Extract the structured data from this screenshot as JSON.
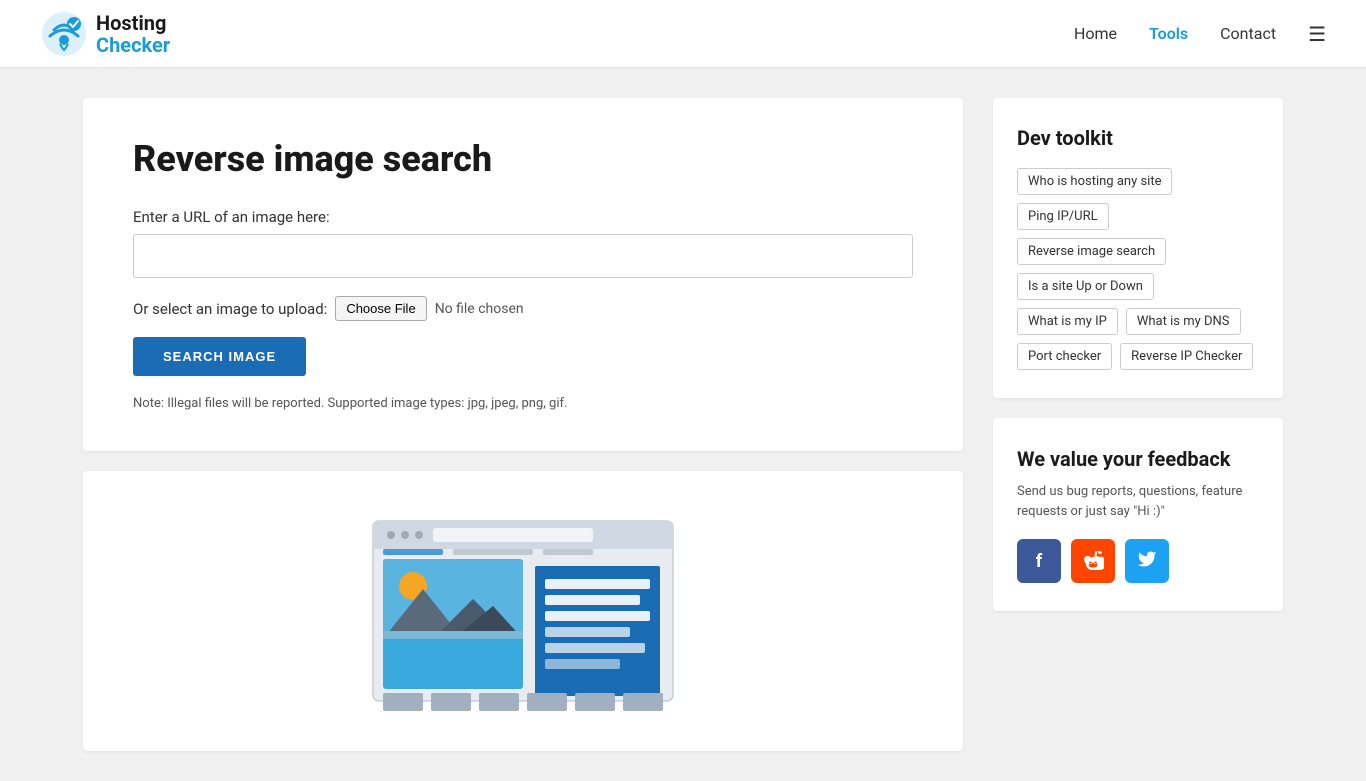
{
  "header": {
    "logo_hosting": "Hosting",
    "logo_checker": "Checker",
    "nav": {
      "home": "Home",
      "tools": "Tools",
      "contact": "Contact"
    }
  },
  "main": {
    "page_title": "Reverse image search",
    "form": {
      "url_label": "Enter a URL of an image here:",
      "url_placeholder": "",
      "file_label": "Or select an image to upload:",
      "file_btn": "Choose File",
      "no_file_text": "No file chosen",
      "search_btn": "SEARCH IMAGE",
      "note": "Note: Illegal files will be reported. Supported image types: jpg, jpeg, png, gif."
    }
  },
  "sidebar": {
    "toolkit_title": "Dev toolkit",
    "tags": [
      "Who is hosting any site",
      "Ping IP/URL",
      "Reverse image search",
      "Is a site Up or Down",
      "What is my IP",
      "What is my DNS",
      "Port checker",
      "Reverse IP Checker"
    ],
    "feedback_title": "We value your feedback",
    "feedback_desc": "Send us bug reports, questions, feature requests or just say \"Hi :)\"",
    "social": {
      "facebook": "f",
      "reddit": "r",
      "twitter": "t"
    }
  }
}
